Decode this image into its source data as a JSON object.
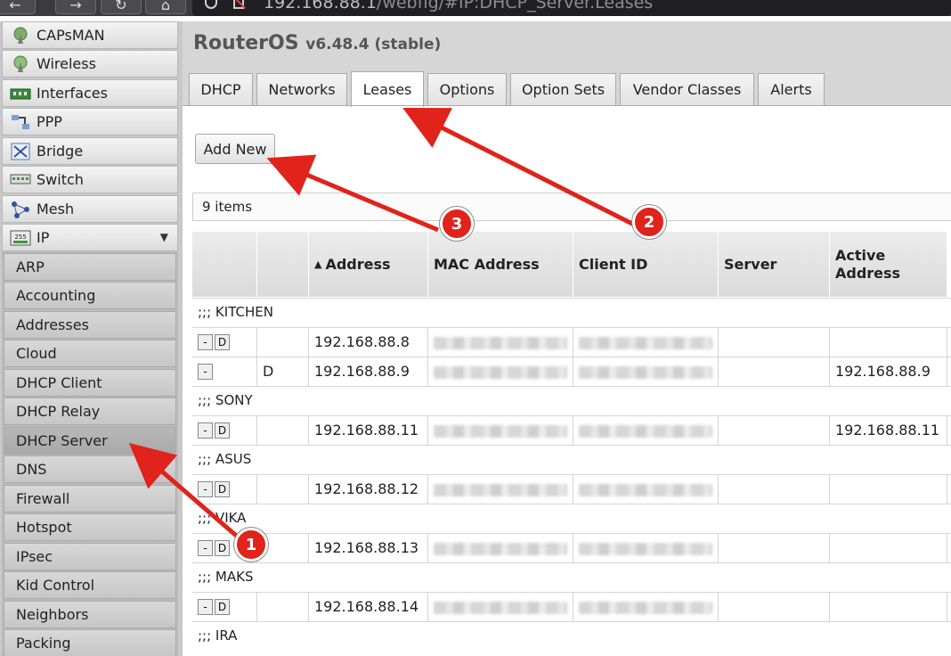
{
  "browser": {
    "url_host": "192.168.88.1",
    "url_path": "/webfig/#IP:DHCP_Server.Leases"
  },
  "sidebar": {
    "menu": [
      {
        "label": "CAPsMAN",
        "icon": "capsman-icon"
      },
      {
        "label": "Wireless",
        "icon": "wireless-icon"
      },
      {
        "label": "Interfaces",
        "icon": "interfaces-icon"
      },
      {
        "label": "PPP",
        "icon": "ppp-icon"
      },
      {
        "label": "Bridge",
        "icon": "bridge-icon"
      },
      {
        "label": "Switch",
        "icon": "switch-icon"
      },
      {
        "label": "Mesh",
        "icon": "mesh-icon"
      },
      {
        "label": "IP",
        "icon": "ip-icon",
        "expanded": true
      }
    ],
    "ip_icon_text": "255",
    "submenu": [
      "ARP",
      "Accounting",
      "Addresses",
      "Cloud",
      "DHCP Client",
      "DHCP Relay",
      "DHCP Server",
      "DNS",
      "Firewall",
      "Hotspot",
      "IPsec",
      "Kid Control",
      "Neighbors",
      "Packing"
    ],
    "active_submenu": "DHCP Server"
  },
  "header": {
    "product": "RouterOS",
    "version": "v6.48.4 (stable)"
  },
  "tabs": [
    {
      "label": "DHCP"
    },
    {
      "label": "Networks"
    },
    {
      "label": "Leases",
      "active": true
    },
    {
      "label": "Options"
    },
    {
      "label": "Option Sets"
    },
    {
      "label": "Vendor Classes"
    },
    {
      "label": "Alerts"
    }
  ],
  "toolbar": {
    "add_new_label": "Add New"
  },
  "list": {
    "count_text": "9 items",
    "columns": [
      "",
      "",
      "Address",
      "MAC Address",
      "Client ID",
      "Server",
      "Active Address"
    ],
    "sort_indicator": "▲",
    "rows": [
      {
        "kind": "group",
        "text": ";;; KITCHEN"
      },
      {
        "kind": "lease",
        "remove": "-",
        "make_static": "D",
        "flag": "",
        "address": "192.168.88.8",
        "active_address": ""
      },
      {
        "kind": "lease",
        "remove": "-",
        "make_static": "",
        "flag": "D",
        "address": "192.168.88.9",
        "active_address": "192.168.88.9"
      },
      {
        "kind": "group",
        "text": ";;; SONY"
      },
      {
        "kind": "lease",
        "remove": "-",
        "make_static": "D",
        "flag": "",
        "address": "192.168.88.11",
        "active_address": "192.168.88.11"
      },
      {
        "kind": "group",
        "text": ";;; ASUS"
      },
      {
        "kind": "lease",
        "remove": "-",
        "make_static": "D",
        "flag": "",
        "address": "192.168.88.12",
        "active_address": ""
      },
      {
        "kind": "group",
        "text": ";;; VIKA"
      },
      {
        "kind": "lease",
        "remove": "-",
        "make_static": "D",
        "flag": "",
        "address": "192.168.88.13",
        "active_address": ""
      },
      {
        "kind": "group",
        "text": ";;; MAKS"
      },
      {
        "kind": "lease",
        "remove": "-",
        "make_static": "D",
        "flag": "",
        "address": "192.168.88.14",
        "active_address": ""
      },
      {
        "kind": "group",
        "text": ";;; IRA"
      }
    ]
  },
  "annotations": [
    {
      "number": "1"
    },
    {
      "number": "2"
    },
    {
      "number": "3"
    }
  ],
  "colors": {
    "annotation": "#e0231b",
    "active_menu": "#acacac"
  }
}
